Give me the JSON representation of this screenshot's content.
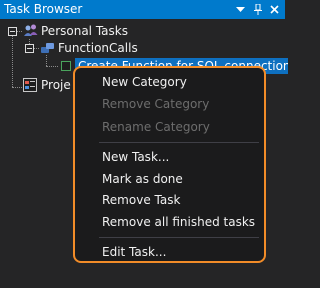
{
  "window": {
    "title": "Task Browser",
    "pin_icon": "pin-icon",
    "close_icon": "close-icon",
    "dropdown_icon": "chevron-down-icon"
  },
  "tree": {
    "nodes": [
      {
        "label": "Personal Tasks",
        "icon": "people-icon"
      },
      {
        "label": "FunctionCalls",
        "icon": "category-icon"
      },
      {
        "label": "Create Function for SQL connection",
        "icon": "task-checkbox-icon",
        "selected": true
      },
      {
        "label": "Proje",
        "icon": "project-icon"
      }
    ]
  },
  "context_menu": {
    "items": [
      {
        "label": "New Category",
        "enabled": true
      },
      {
        "label": "Remove Category",
        "enabled": false
      },
      {
        "label": "Rename Category",
        "enabled": false
      },
      {
        "label": "New Task...",
        "enabled": true
      },
      {
        "label": "Mark as done",
        "enabled": true
      },
      {
        "label": "Remove Task",
        "enabled": true
      },
      {
        "label": "Remove all finished tasks",
        "enabled": true
      },
      {
        "label": "Edit Task...",
        "enabled": true
      }
    ]
  },
  "colors": {
    "titlebar": "#007acc",
    "panel_bg": "#252526",
    "selection": "#0e70c0",
    "menu_border_highlight": "#f28c28",
    "disabled_text": "#6d6d6d"
  }
}
